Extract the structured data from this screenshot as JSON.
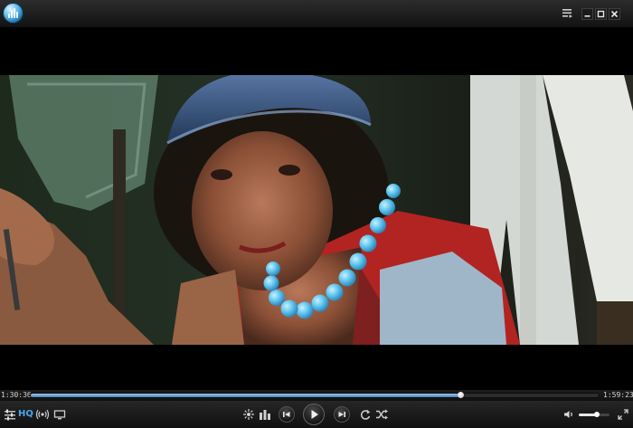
{
  "window": {
    "title": ""
  },
  "player": {
    "elapsed": "1:30:36",
    "duration": "1:59:23",
    "progress": 0.756,
    "volume": 0.6,
    "quality_label": "HQ"
  },
  "colors": {
    "accent": "#4aa8ee",
    "seek_fill": "#6fa3d2"
  },
  "icons": {
    "app_logo": "app-logo",
    "playlist": "playlist-icon",
    "minimize": "minimize-icon",
    "maximize": "maximize-icon",
    "close": "close-icon",
    "settings": "equalizer-settings-icon",
    "broadcast": "broadcast-icon",
    "screen": "screen-icon",
    "effects": "effects-icon",
    "chapters": "chapters-icon",
    "previous": "previous-icon",
    "play": "play-icon",
    "next": "next-icon",
    "repeat": "repeat-icon",
    "shuffle": "shuffle-icon",
    "volume": "volume-icon",
    "fullscreen": "fullscreen-icon"
  }
}
